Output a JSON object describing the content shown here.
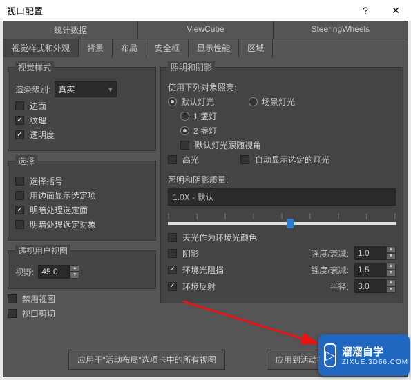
{
  "titlebar": {
    "title": "视口配置"
  },
  "tabs1": [
    "统计数据",
    "ViewCube",
    "SteeringWheels"
  ],
  "tabs2": [
    "视觉样式和外观",
    "背景",
    "布局",
    "安全框",
    "显示性能",
    "区域"
  ],
  "visual_style": {
    "legend": "视觉样式",
    "render_level_label": "渲染级别:",
    "render_level_value": "真实",
    "edges": "边面",
    "texture": "纹理",
    "transparency": "透明度"
  },
  "selection": {
    "legend": "选择",
    "brackets": "选择括号",
    "edge_faces": "用边面显示选定项",
    "shade_selected": "明暗处理选定面",
    "shade_selected_obj": "明暗处理选定对象"
  },
  "perspective_view": {
    "legend": "透视用户视图",
    "fov_label": "视野:",
    "fov_value": "45.0"
  },
  "disable_view": "禁用视图",
  "view_clip": "视口剪切",
  "lighting": {
    "legend": "照明和阴影",
    "illuminate_with": "使用下列对象照亮:",
    "default_light": "默认灯光",
    "scene_light": "场景灯光",
    "one_light": "1 盏灯",
    "two_light": "2 盏灯",
    "follow_view": "默认灯光跟随视角",
    "highlight": "高光",
    "auto_show_selected": "自动显示选定的灯光",
    "quality_label": "照明和阴影质量:",
    "quality_value": "1.0X - 默认",
    "skylight": "天光作为环境光颜色",
    "shadow": "阴影",
    "ao": "环境光阻挡",
    "reflection": "环境反射",
    "intensity_decay": "强度/衰减:",
    "radius": "半径:",
    "val_intensity1": "1.0",
    "val_intensity2": "1.5",
    "val_radius": "3.0"
  },
  "buttons": {
    "apply_all": "应用于\"活动布局\"选项卡中的所有视图",
    "apply_active": "应用到活动视图"
  },
  "watermark": {
    "brand": "溜溜自学",
    "url": "ZIXUE.3D66.COM"
  }
}
